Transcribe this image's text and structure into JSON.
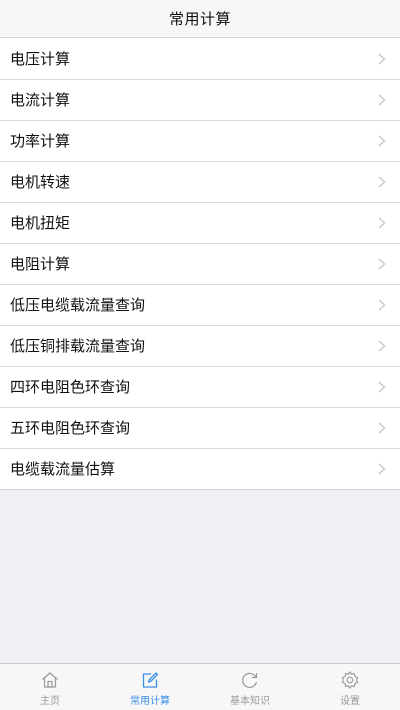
{
  "header": {
    "title": "常用计算"
  },
  "list": {
    "items": [
      {
        "label": "电压计算"
      },
      {
        "label": "电流计算"
      },
      {
        "label": "功率计算"
      },
      {
        "label": "电机转速"
      },
      {
        "label": "电机扭矩"
      },
      {
        "label": "电阻计算"
      },
      {
        "label": "低压电缆载流量查询"
      },
      {
        "label": "低压铜排载流量查询"
      },
      {
        "label": "四环电阻色环查询"
      },
      {
        "label": "五环电阻色环查询"
      },
      {
        "label": "电缆载流量估算"
      }
    ]
  },
  "tabbar": {
    "tabs": [
      {
        "label": "主页",
        "icon": "home-icon"
      },
      {
        "label": "常用计算",
        "icon": "edit-icon",
        "active": true
      },
      {
        "label": "基本知识",
        "icon": "refresh-icon"
      },
      {
        "label": "设置",
        "icon": "gear-icon"
      }
    ]
  },
  "colors": {
    "active": "#3a8ee6",
    "inactive": "#9a9a9e",
    "background": "#f0eff5"
  }
}
